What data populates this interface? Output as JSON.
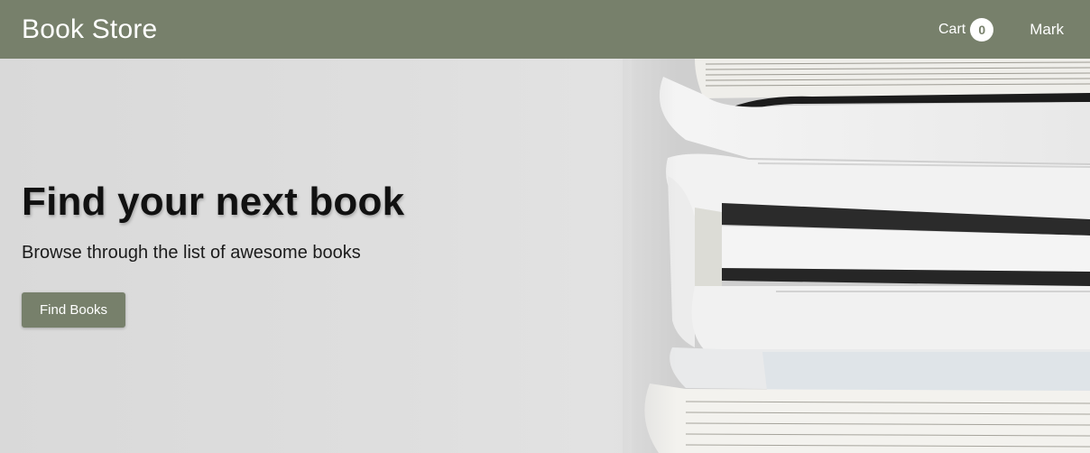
{
  "header": {
    "brand": "Book Store",
    "cart_label": "Cart",
    "cart_count": "0",
    "user_name": "Mark"
  },
  "hero": {
    "title": "Find your next book",
    "subtitle": "Browse through the list of awesome books",
    "button_label": "Find Books",
    "image_icon": "stacked-books-photo"
  },
  "colors": {
    "accent": "#77806b",
    "hero_background": "#e2e2e2"
  }
}
